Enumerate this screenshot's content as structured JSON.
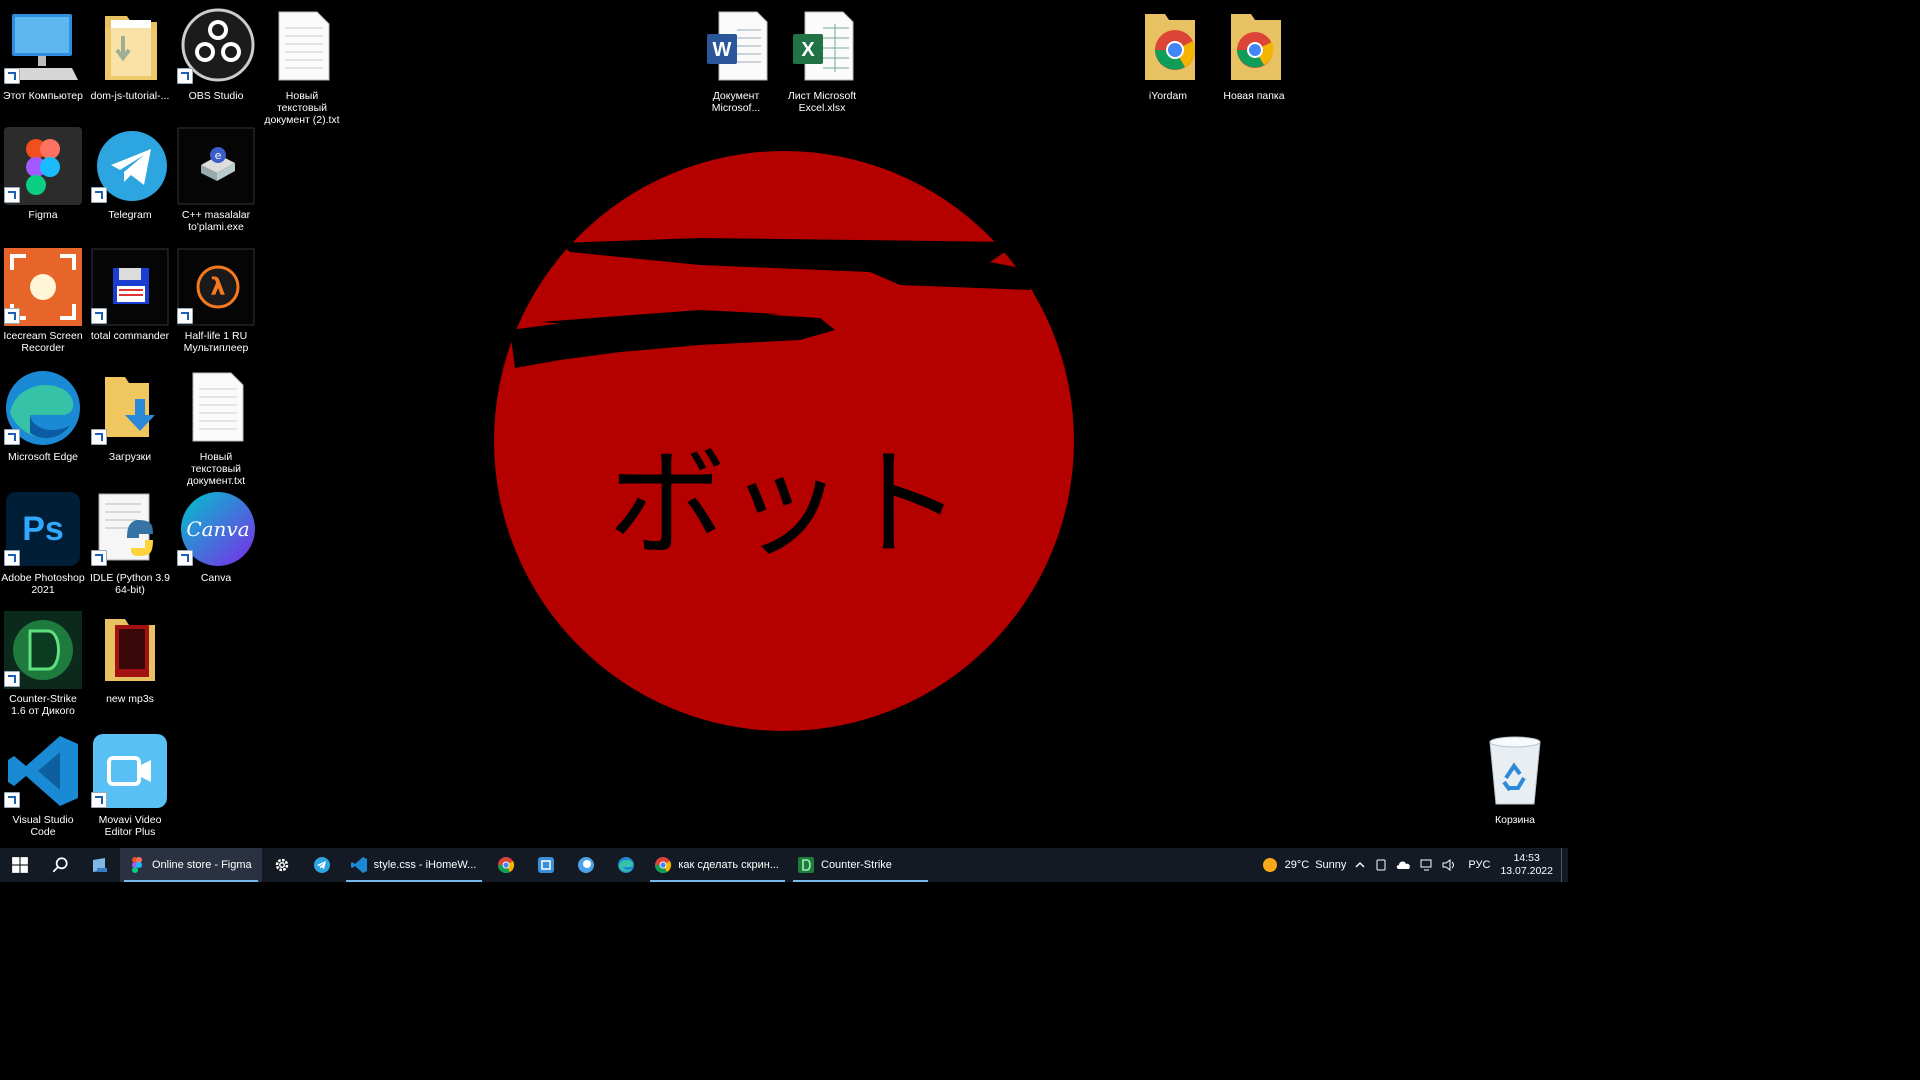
{
  "wallpaper": {
    "katakana": "ボット",
    "circle_color": "#b50000"
  },
  "desktop_icons": {
    "this_pc": "Этот Компьютер",
    "dom_js": "dom-js-tutorial-...",
    "obs": "OBS Studio",
    "new_txt_2": "Новый текстовый документ (2).txt",
    "word_doc": "Документ Microsof...",
    "excel_sheet": "Лист Microsoft Excel.xlsx",
    "iyordam": "iYordam",
    "new_folder": "Новая папка",
    "figma": "Figma",
    "telegram": "Telegram",
    "cpp_exe": "C++ masalalar to'plami.exe",
    "icecream": "Icecream Screen Recorder",
    "total_commander": "total commander",
    "half_life": "Half-life 1 RU Мультиплеер",
    "edge": "Microsoft Edge",
    "downloads": "Загрузки",
    "new_txt": "Новый текстовый документ.txt",
    "photoshop": "Adobe Photoshop 2021",
    "idle": "IDLE (Python 3.9 64-bit)",
    "canva": "Canva",
    "counter_strike": "Counter-Strike 1.6 от Дикого",
    "new_mp3s": "new mp3s",
    "vscode": "Visual Studio Code",
    "movavi": "Movavi Video Editor Plus",
    "recycle_bin": "Корзина"
  },
  "taskbar": {
    "figma_window": "Online store - Figma",
    "vscode_window": "style.css - iHomeW...",
    "chrome_window": "как сделать скрин...",
    "cs_window": "Counter-Strike",
    "weather_temp": "29°C",
    "weather_cond": "Sunny",
    "language": "РУС",
    "time": "14:53",
    "date": "13.07.2022"
  }
}
